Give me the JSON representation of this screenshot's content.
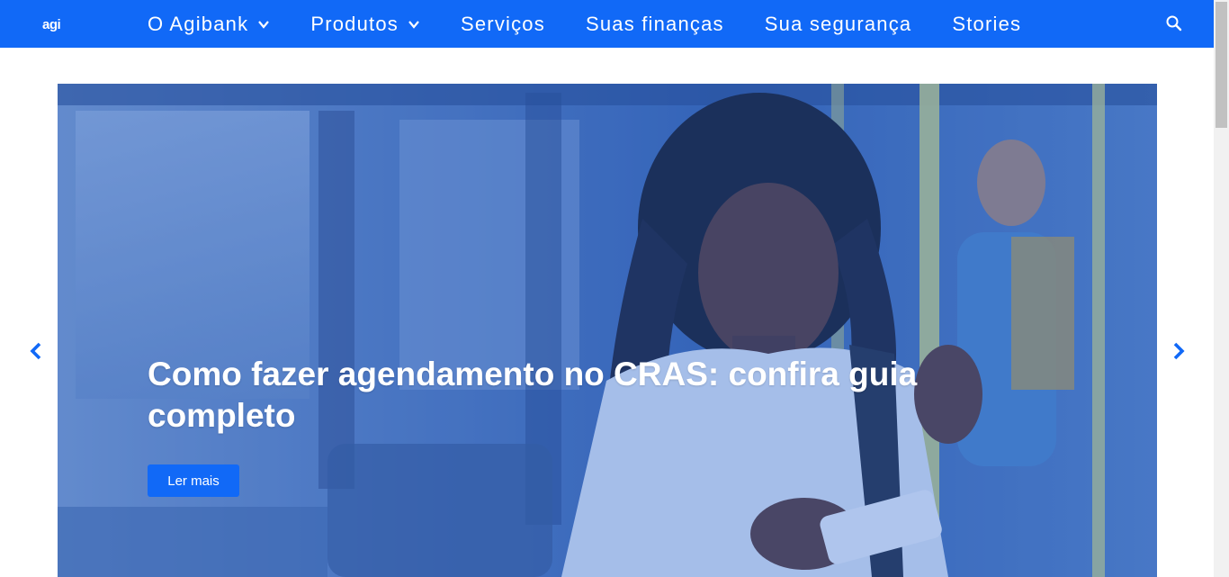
{
  "header": {
    "logo_text": "agi",
    "nav": [
      {
        "label": "O Agibank",
        "has_dropdown": true
      },
      {
        "label": "Produtos",
        "has_dropdown": true
      },
      {
        "label": "Serviços",
        "has_dropdown": false
      },
      {
        "label": "Suas finanças",
        "has_dropdown": false
      },
      {
        "label": "Sua segurança",
        "has_dropdown": false
      },
      {
        "label": "Stories",
        "has_dropdown": false
      }
    ],
    "search_icon": "search-icon"
  },
  "hero": {
    "title": "Como fazer agendamento no CRAS: confira guia completo",
    "button_label": "Ler mais",
    "prev_icon": "chevron-left-icon",
    "next_icon": "chevron-right-icon"
  },
  "colors": {
    "brand_blue": "#1169f7",
    "arrow_blue": "#1169f7",
    "white": "#ffffff"
  }
}
